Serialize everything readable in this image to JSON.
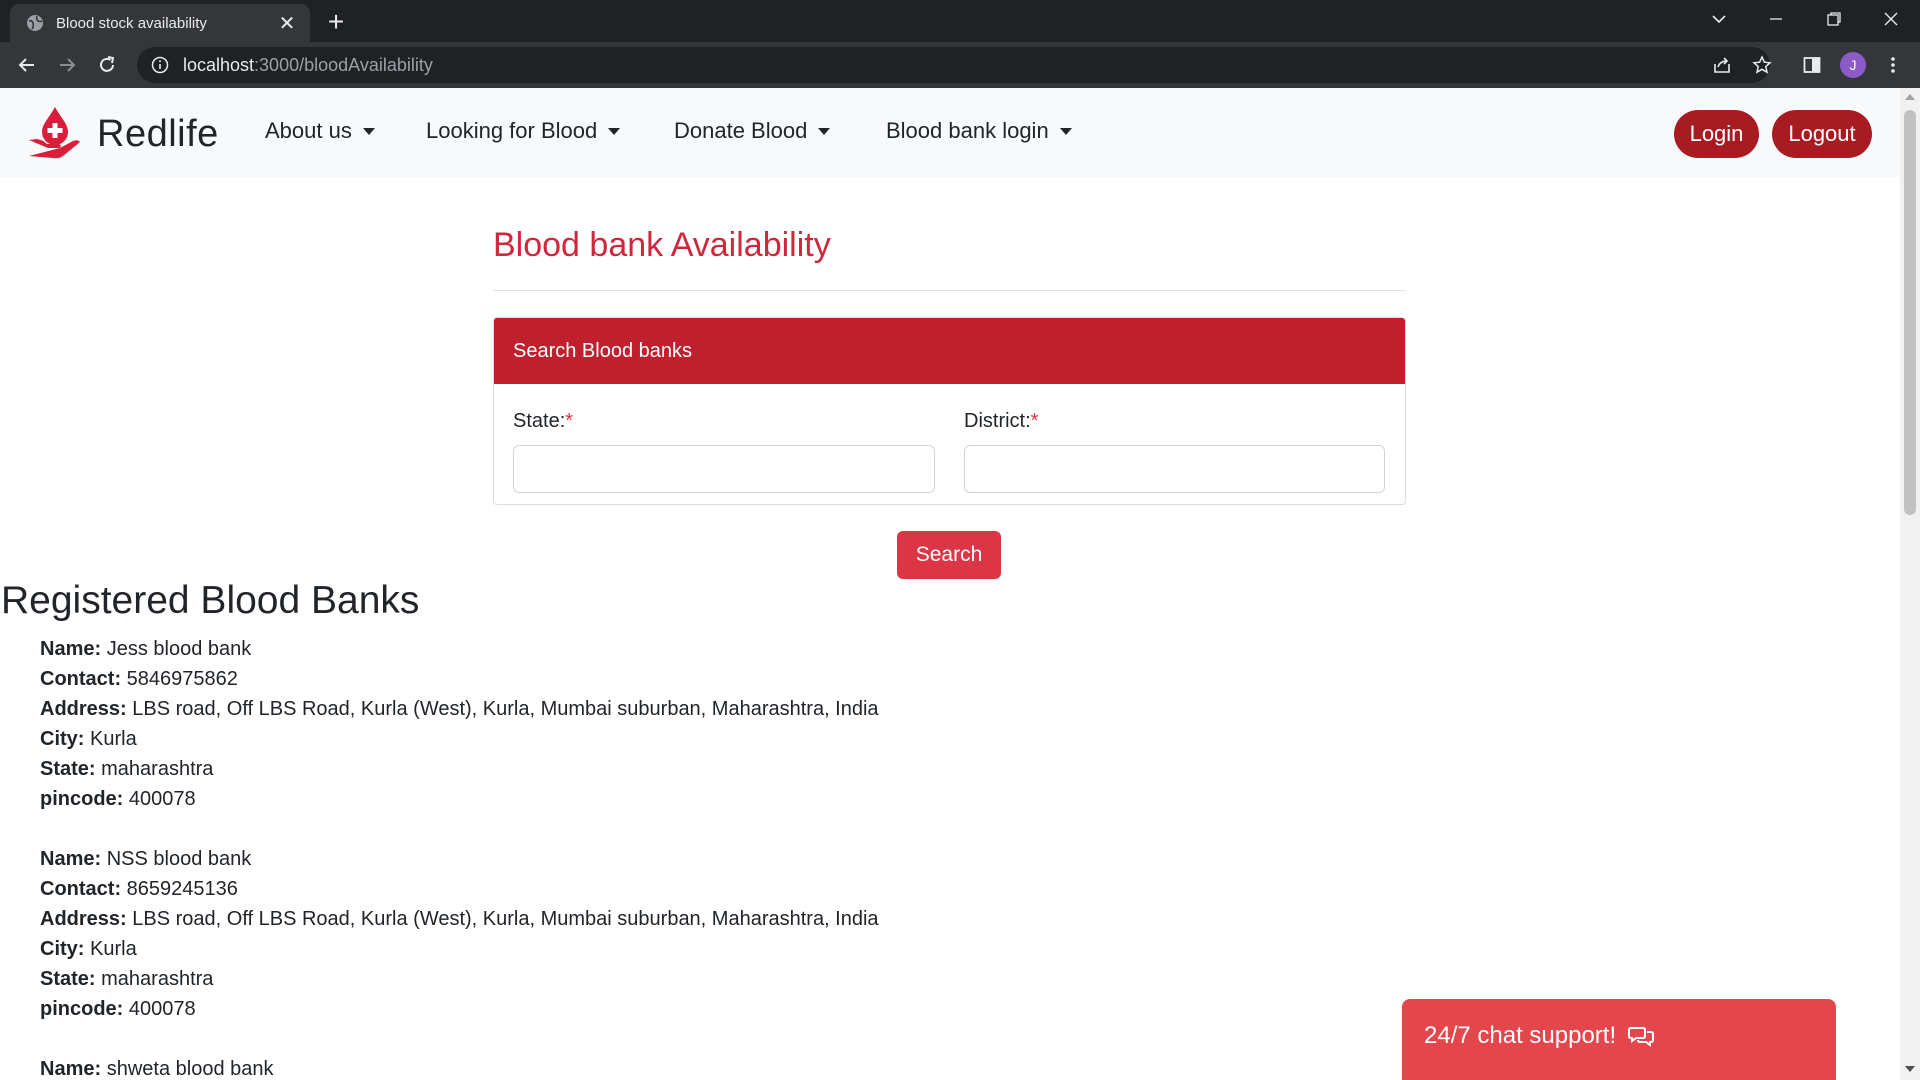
{
  "browser": {
    "tab_title": "Blood stock availability",
    "tab_close": "✕",
    "new_tab": "+",
    "url_host": "localhost",
    "url_path": ":3000/bloodAvailability",
    "profile_initial": "J"
  },
  "nav": {
    "brand": "Redlife",
    "menu": [
      {
        "label": "About us"
      },
      {
        "label": "Looking for Blood"
      },
      {
        "label": "Donate Blood"
      },
      {
        "label": "Blood bank login"
      }
    ],
    "login": "Login",
    "logout": "Logout",
    "accent": "#a81b23"
  },
  "page": {
    "title": "Blood bank Availability",
    "title_color": "#d1263b"
  },
  "search_card": {
    "header": "Search Blood banks",
    "header_color": "#c0202e",
    "state_label": "State:",
    "district_label": "District:",
    "required_mark": "*",
    "state_value": "",
    "district_value": "",
    "button": "Search"
  },
  "registered": {
    "heading": "Registered Blood Banks",
    "field_labels": {
      "name": "Name:",
      "contact": "Contact:",
      "address": "Address:",
      "city": "City:",
      "state": "State:",
      "pincode": "pincode:"
    },
    "banks": [
      {
        "name": "Jess blood bank",
        "contact": "5846975862",
        "address": "LBS road, Off LBS Road, Kurla (West), Kurla, Mumbai suburban, Maharashtra, India",
        "city": "Kurla",
        "state": "maharashtra",
        "pincode": "400078"
      },
      {
        "name": "NSS blood bank",
        "contact": "8659245136",
        "address": "LBS road, Off LBS Road, Kurla (West), Kurla, Mumbai suburban, Maharashtra, India",
        "city": "Kurla",
        "state": "maharashtra",
        "pincode": "400078"
      },
      {
        "name": "shweta blood bank"
      }
    ]
  },
  "chat": {
    "label": "24/7 chat support!",
    "icon": "comments-icon",
    "color": "#e4474b"
  }
}
